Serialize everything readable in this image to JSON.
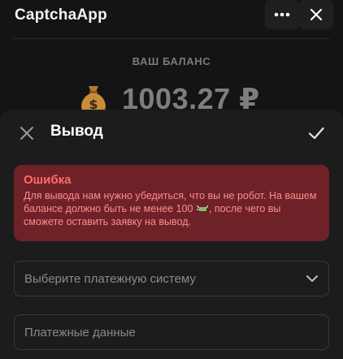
{
  "app": {
    "title": "CaptchaApp",
    "icons": {
      "more": "more-dots-icon",
      "close": "close-icon"
    }
  },
  "balance": {
    "label": "ВАШ БАЛАНС",
    "amount": "1003.27 ₽",
    "icon": "money-bag-icon"
  },
  "sheet": {
    "title": "Вывод",
    "icons": {
      "close": "close-icon",
      "confirm": "checkmark-icon"
    },
    "error": {
      "title": "Ошибка",
      "text_before": "Для вывода нам нужно убедиться, что вы не робот. На вашем балансе должно быть не менее 100",
      "text_after": ", после чего вы сможете оставить заявку на вывод.",
      "icon": "money-with-wings-icon"
    },
    "payment_system": {
      "placeholder": "Выберите платежную систему",
      "icon": "chevron-down-icon"
    },
    "payment_details": {
      "placeholder": "Платежные данные"
    }
  },
  "colors": {
    "background": "#141414",
    "sheet": "#1c1c1c",
    "error_bg": "#6e2227",
    "error_title": "#ff6b6b",
    "error_text": "#ff8c8c"
  }
}
